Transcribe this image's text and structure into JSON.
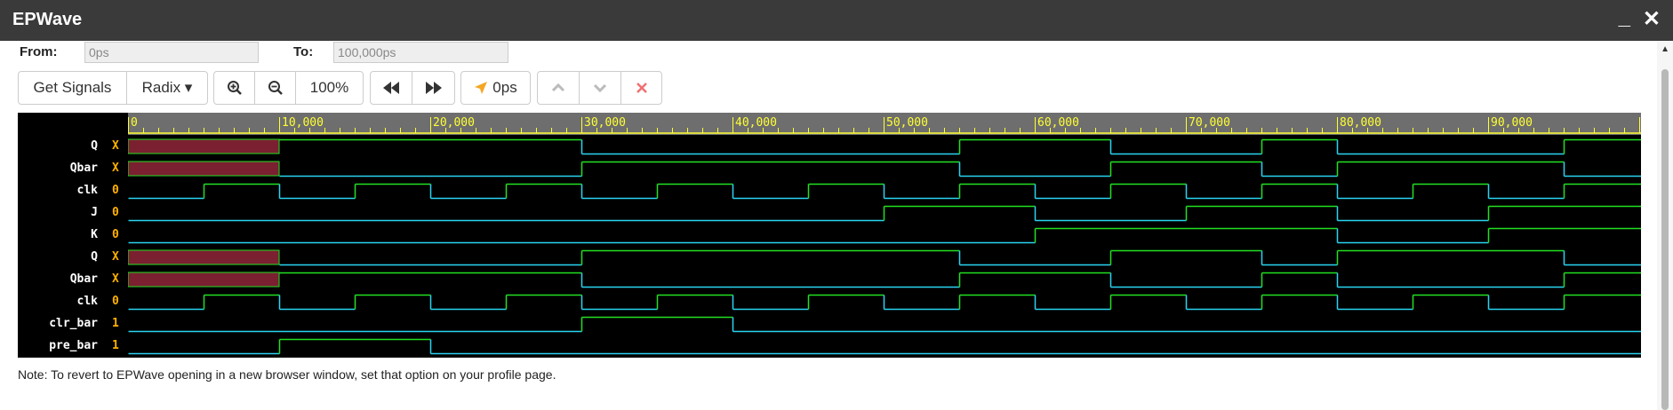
{
  "window": {
    "title": "EPWave",
    "minimize": "_",
    "close": "✕"
  },
  "range": {
    "from_label": "From:",
    "from_value": "0ps",
    "to_label": "To:",
    "to_value": "100,000ps"
  },
  "toolbar": {
    "get_signals": "Get Signals",
    "radix": "Radix ▾",
    "zoom_in_icon": "zoom-in-icon",
    "zoom_out_icon": "zoom-out-icon",
    "zoom": "100%",
    "rewind_icon": "rewind-icon",
    "fast_forward_icon": "fast-forward-icon",
    "cursor_icon": "cursor-icon",
    "cursor_time": "0ps",
    "up_icon": "chevron-up-icon",
    "down_icon": "chevron-down-icon",
    "delete_icon": "close-icon"
  },
  "ruler": {
    "labels": [
      "0",
      "10,000",
      "20,000",
      "30,000",
      "40,000",
      "50,000",
      "60,000",
      "70,000",
      "80,000",
      "90,000"
    ],
    "max_time": 100000
  },
  "signals": [
    {
      "name": "Q",
      "value": "X"
    },
    {
      "name": "Qbar",
      "value": "X"
    },
    {
      "name": "clk",
      "value": "0"
    },
    {
      "name": "J",
      "value": "0"
    },
    {
      "name": "K",
      "value": "0"
    },
    {
      "name": "Q",
      "value": "X"
    },
    {
      "name": "Qbar",
      "value": "X"
    },
    {
      "name": "clk",
      "value": "0"
    },
    {
      "name": "clr_bar",
      "value": "1"
    },
    {
      "name": "pre_bar",
      "value": "1"
    }
  ],
  "note": "Note: To revert to EPWave opening in a new browser window, set that option on your profile page.",
  "colors": {
    "high": "#22e022",
    "low": "#2ad4f2",
    "unknown": "#7a2030",
    "ruler_bg": "#6e6e6e",
    "ruler_fg": "#ffff33",
    "value": "#ffb000"
  }
}
